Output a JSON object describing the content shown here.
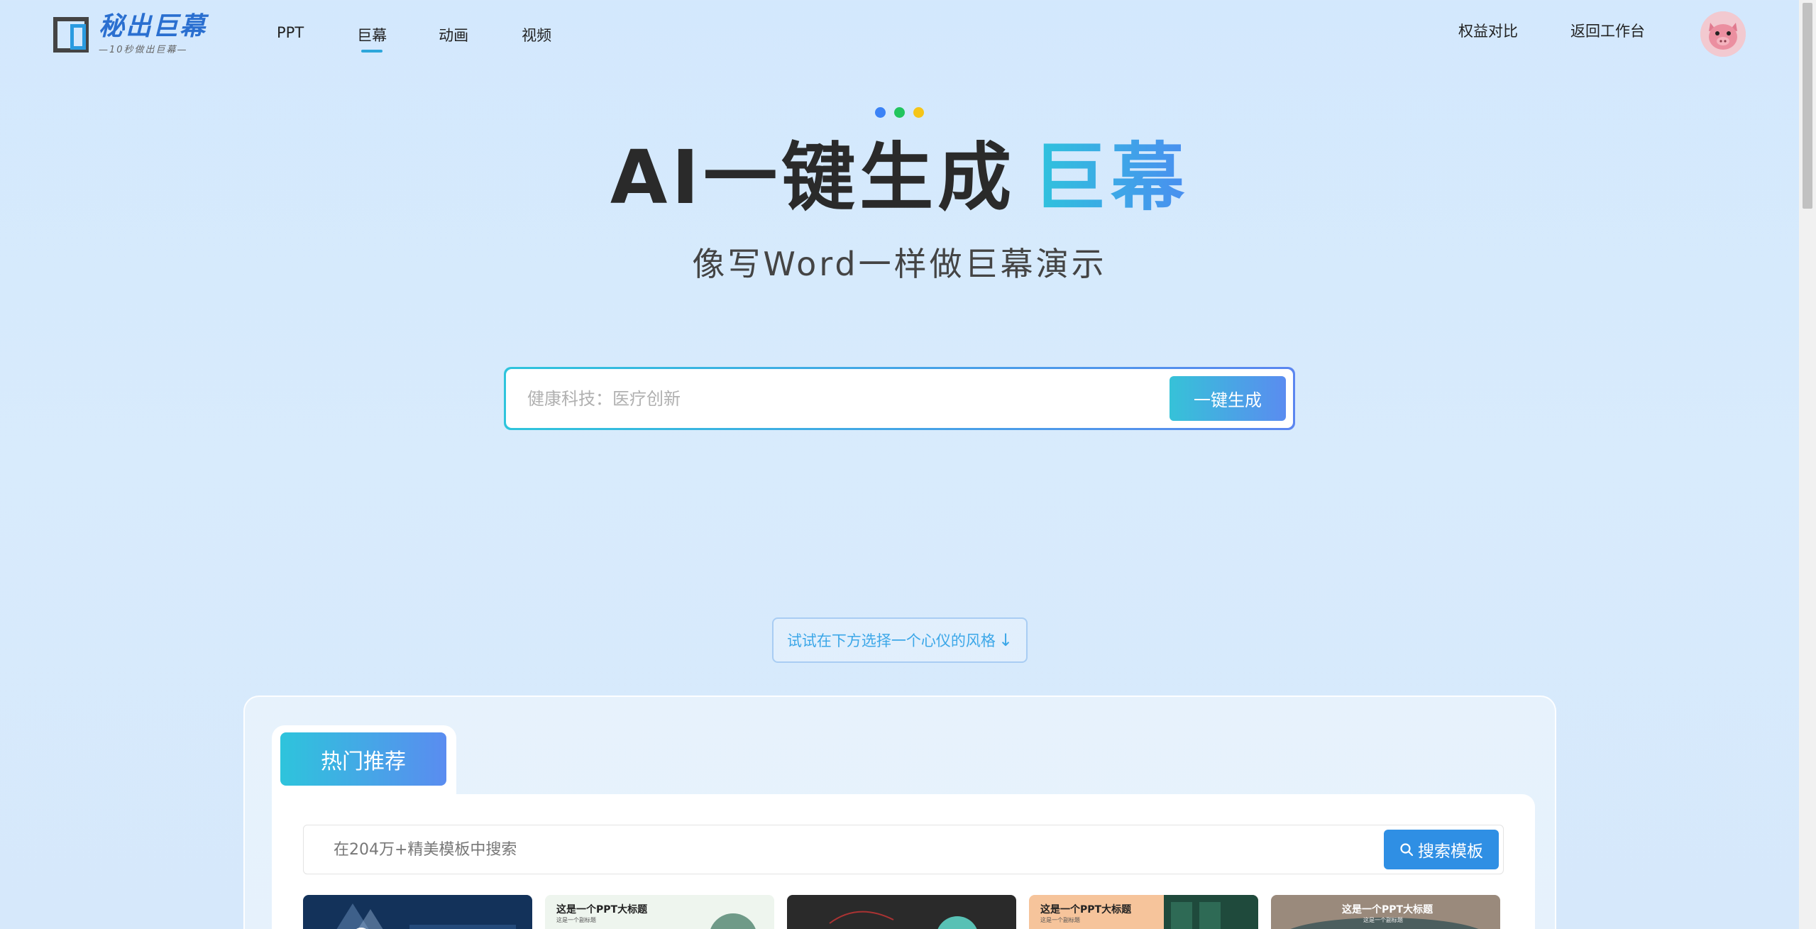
{
  "logo": {
    "title": "秘出巨幕",
    "subtitle": "—10秒做出巨幕—"
  },
  "nav": {
    "items": [
      "PPT",
      "巨幕",
      "动画",
      "视频"
    ],
    "active_index": 1
  },
  "header_links": [
    "权益对比",
    "返回工作台"
  ],
  "hero": {
    "dot_colors": [
      "#3b82f6",
      "#22c55e",
      "#f5c518"
    ],
    "title_main": "AI一键生成",
    "title_accent": "巨幕",
    "subtitle": "像写Word一样做巨幕演示"
  },
  "generator": {
    "placeholder": "健康科技：医疗创新",
    "button_label": "一键生成"
  },
  "hint": {
    "text": "试试在下方选择一个心仪的风格",
    "arrow": "↓"
  },
  "templates": {
    "tab_label": "热门推荐",
    "search_placeholder": "在204万+精美模板中搜索",
    "search_button": "搜索模板",
    "cards": [
      {
        "title": "",
        "subtitle": "",
        "bg": "#13325a"
      },
      {
        "title": "这是一个PPT大标题",
        "subtitle": "这是一个副标题",
        "bg": "#eef5ee"
      },
      {
        "title": "",
        "subtitle": "",
        "bg": "#2a2a2a"
      },
      {
        "title": "这是一个PPT大标题",
        "subtitle": "这是一个副标题",
        "bg": "#f6c49b"
      },
      {
        "title": "这是一个PPT大标题",
        "subtitle": "这是一个副标题",
        "bg": "#9a8a7c"
      }
    ]
  },
  "colors": {
    "accent_start": "#2ec4dc",
    "accent_end": "#5a8cf0",
    "search_button": "#2f8fe4"
  }
}
